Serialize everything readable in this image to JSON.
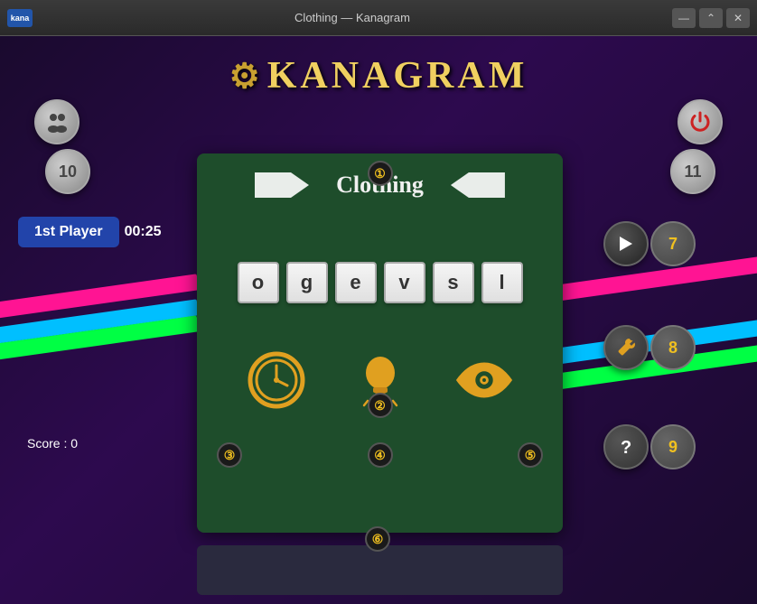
{
  "titlebar": {
    "title": "Clothing — Kanagram",
    "app_label": "kana",
    "btn_minimize": "—",
    "btn_maximize": "⌃",
    "btn_close": "✕"
  },
  "logo": {
    "text": "KANAGRAM",
    "gear_symbol": "⚙"
  },
  "buttons": {
    "players_icon": "👥",
    "power_icon": "⏻",
    "hint_count": "10",
    "level": "11",
    "next_arrow": "→",
    "next_badge": "7",
    "wrench_icon": "🔧",
    "wrench_badge": "8",
    "help_icon": "?",
    "help_badge": "9"
  },
  "player": {
    "name": "1st Player",
    "timer": "00:25"
  },
  "score": {
    "label": "Score : 0"
  },
  "game": {
    "category": "Clothing",
    "letters": [
      "o",
      "g",
      "e",
      "v",
      "s",
      "l"
    ],
    "badges": {
      "nav": "❶",
      "letters": "❷",
      "clock": "❸",
      "hint": "❹",
      "reveal": "❺",
      "input": "❻"
    }
  }
}
